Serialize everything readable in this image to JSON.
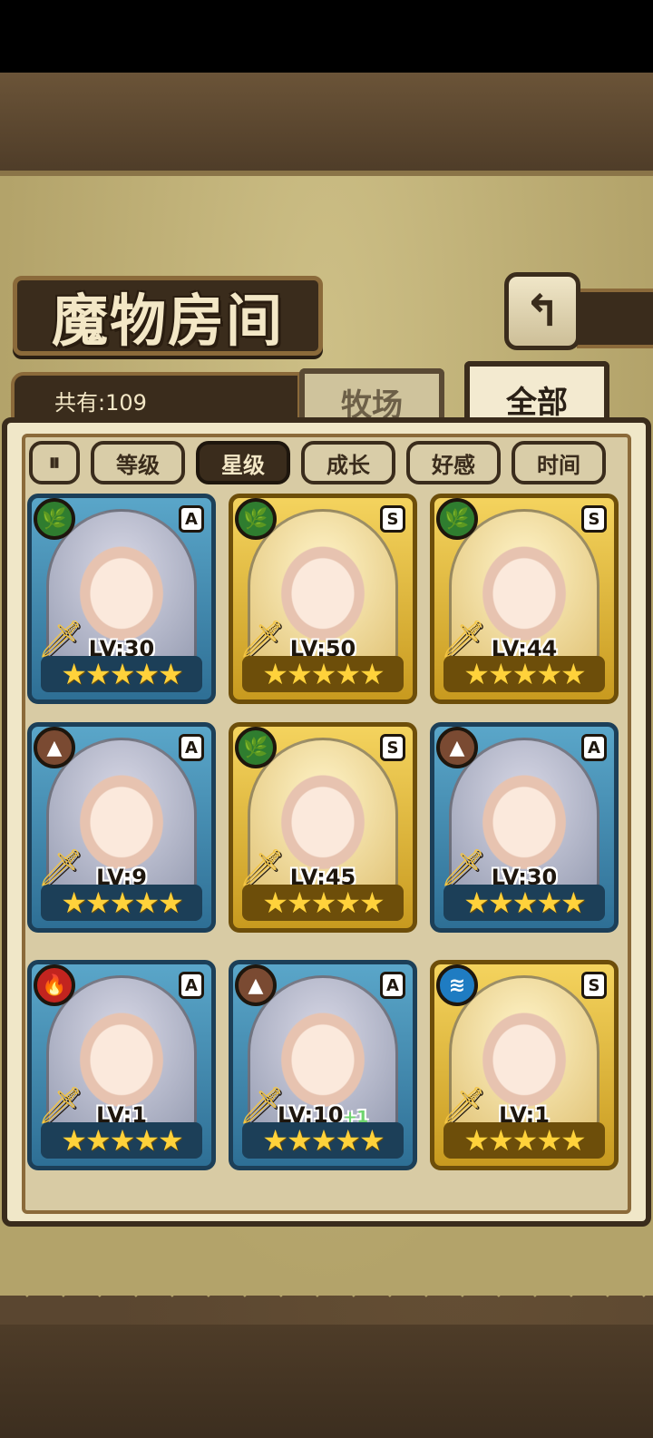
{
  "title": "魔物房间",
  "back_icon": "↰",
  "count_label": "共有:109",
  "tabs": {
    "ranch": "牧场",
    "all": "全部"
  },
  "sort": {
    "toggle_icon": "⏸",
    "buttons": [
      "等级",
      "星级",
      "成长",
      "好感",
      "时间"
    ],
    "active": "星级"
  },
  "colors": {
    "rarity_A_frame": "#2e6f95",
    "rarity_S_frame": "#c89a1f",
    "element_nature": "#2f7d2f",
    "element_earth": "#7a4a32",
    "element_fire": "#c2241f",
    "element_water": "#1f7cc2"
  },
  "monsters": [
    {
      "element": "nature",
      "element_icon": "🌿",
      "rank": "A",
      "level": "LV:30",
      "bonus": "",
      "stars": "★★★★★",
      "weapon": "sword-icon"
    },
    {
      "element": "nature",
      "element_icon": "🌿",
      "rank": "S",
      "level": "LV:50",
      "bonus": "",
      "stars": "★★★★★",
      "weapon": "sword-icon"
    },
    {
      "element": "nature",
      "element_icon": "🌿",
      "rank": "S",
      "level": "LV:44",
      "bonus": "",
      "stars": "★★★★★",
      "weapon": "sword-icon"
    },
    {
      "element": "earth",
      "element_icon": "▲",
      "rank": "A",
      "level": "LV:9",
      "bonus": "",
      "stars": "★★★★★",
      "weapon": "sword-icon"
    },
    {
      "element": "nature",
      "element_icon": "🌿",
      "rank": "S",
      "level": "LV:45",
      "bonus": "",
      "stars": "★★★★★",
      "weapon": "sword-icon"
    },
    {
      "element": "earth",
      "element_icon": "▲",
      "rank": "A",
      "level": "LV:30",
      "bonus": "",
      "stars": "★★★★★",
      "weapon": "sword-icon"
    },
    {
      "element": "fire",
      "element_icon": "🔥",
      "rank": "A",
      "level": "LV:1",
      "bonus": "",
      "stars": "★★★★★",
      "weapon": "sword-icon"
    },
    {
      "element": "earth",
      "element_icon": "▲",
      "rank": "A",
      "level": "LV:10",
      "bonus": "+1",
      "stars": "★★★★★",
      "weapon": "sword-icon"
    },
    {
      "element": "water",
      "element_icon": "≋",
      "rank": "S",
      "level": "LV:1",
      "bonus": "",
      "stars": "★★★★★",
      "weapon": "sword-icon"
    }
  ]
}
